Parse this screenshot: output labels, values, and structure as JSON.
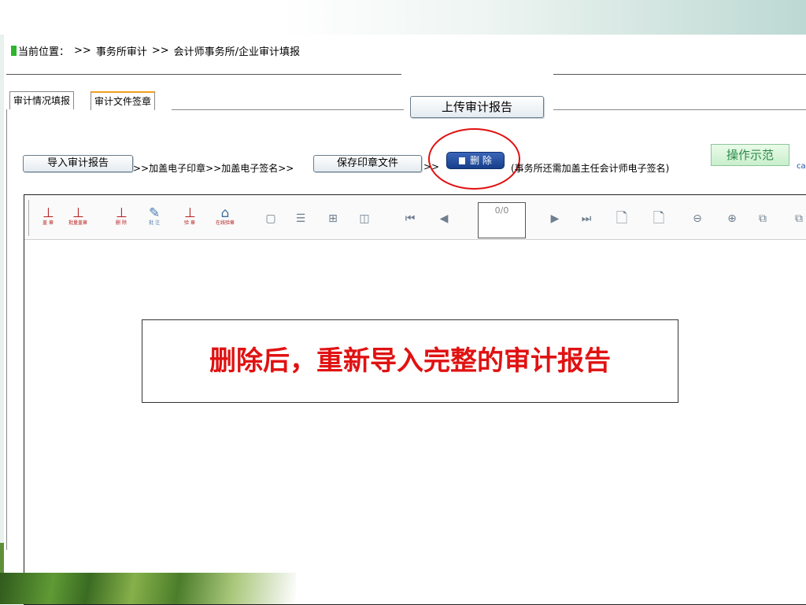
{
  "breadcrumb": {
    "label": "当前位置：",
    "sep1": ">>",
    "item1": "事务所审计",
    "sep2": ">>",
    "item2": "会计师事务所/企业审计填报"
  },
  "tabs": [
    {
      "label": "审计情况填报"
    },
    {
      "label": "审计文件签章"
    }
  ],
  "toolbar": {
    "upload_label": "上传审计报告",
    "import_label": "导入审计报告",
    "step_text_1": ">>加盖电子印章>>加盖电子签名>>",
    "save_label": "保存印章文件",
    "step_arrow": ">>",
    "delete_label": "删 除",
    "note_text": "(事务所还需加盖主任会计师电子签名)",
    "demo_label": "操作示范",
    "cut_text": "ca"
  },
  "viewer": {
    "stamp_tools": [
      {
        "label": "盖 章",
        "icon": "stamp-icon"
      },
      {
        "label": "批量盖章",
        "icon": "batch-stamp-icon"
      },
      {
        "label": "删 除",
        "icon": "delete-stamp-icon"
      },
      {
        "label": "批 注",
        "icon": "annotate-icon"
      },
      {
        "label": "验 章",
        "icon": "verify-stamp-icon"
      },
      {
        "label": "在线验章",
        "icon": "online-verify-icon"
      }
    ],
    "page_counter": "0/0"
  },
  "callout": {
    "text": "删除后，重新导入完整的审计报告"
  },
  "colors": {
    "accent_red": "#e01212",
    "delete_blue": "#1d4a9a",
    "demo_green": "#2d8a4a",
    "breadcrumb_marker": "#2db52d"
  }
}
